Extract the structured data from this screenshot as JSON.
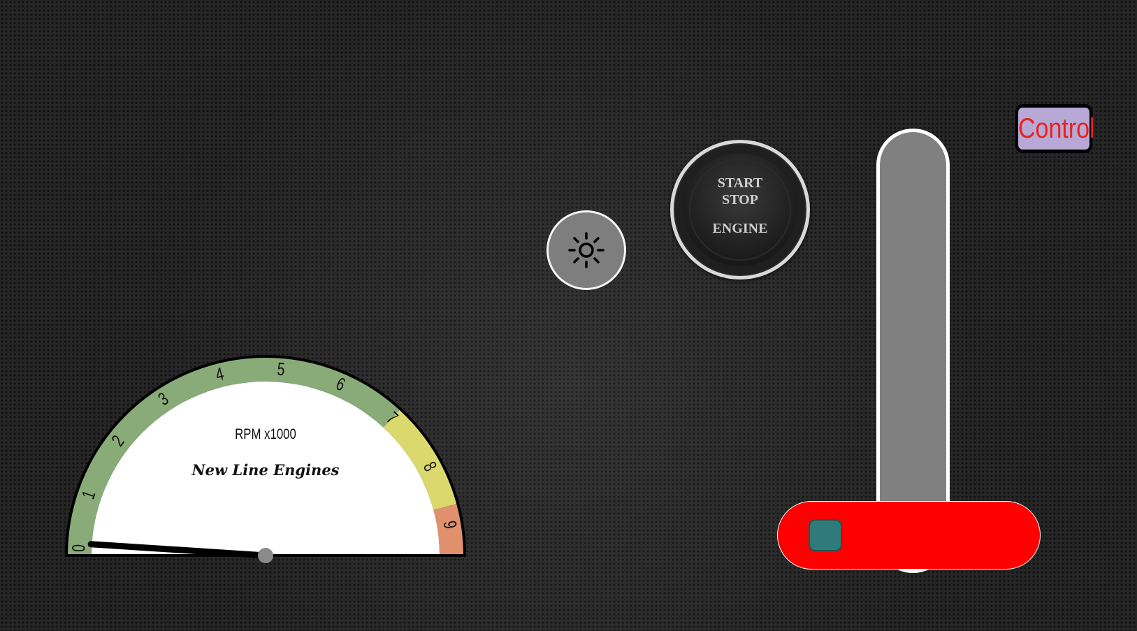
{
  "gauge": {
    "unit_label": "RPM x1000",
    "brand": "New Line Engines",
    "ticks": [
      "0",
      "1",
      "2",
      "3",
      "4",
      "5",
      "6",
      "7",
      "8",
      "9"
    ],
    "value": 0.1,
    "max": 9.5,
    "zones": [
      {
        "from": 0,
        "to": 7,
        "color": "#88ab78"
      },
      {
        "from": 7,
        "to": 8.7,
        "color": "#dbd86e"
      },
      {
        "from": 8.7,
        "to": 9.5,
        "color": "#e0906d"
      }
    ]
  },
  "light_button": {
    "icon": "sun-icon"
  },
  "engine_button": {
    "line1": "START",
    "line2": "STOP",
    "line3": "ENGINE"
  },
  "vertical_slider": {
    "track_color": "#808080"
  },
  "horizontal_slider": {
    "bar_color": "#ff0000",
    "knob_color": "#2f7b7b",
    "value": 0
  },
  "control_button": {
    "label": "Control"
  },
  "colors": {
    "background": "#262626",
    "control_bg": "#b7a8d6",
    "control_text": "#e8221f"
  }
}
